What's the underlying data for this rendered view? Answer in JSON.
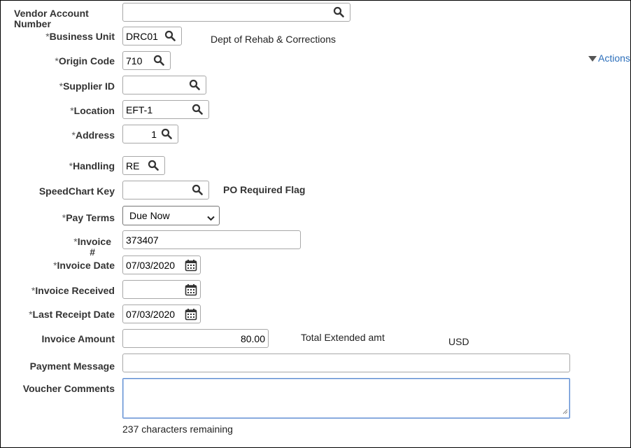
{
  "form": {
    "vendor_account_number": {
      "label": "Vendor Account Number",
      "value": ""
    },
    "business_unit": {
      "label": "Business Unit",
      "value": "DRC01",
      "description": "Dept of Rehab & Corrections"
    },
    "origin_code": {
      "label": "Origin Code",
      "value": "710"
    },
    "supplier_id": {
      "label": "Supplier ID",
      "value": ""
    },
    "location": {
      "label": "Location",
      "value": "EFT-1"
    },
    "address": {
      "label": "Address",
      "value": "1"
    },
    "handling": {
      "label": "Handling",
      "value": "RE"
    },
    "speedchart_key": {
      "label": "SpeedChart Key",
      "value": "",
      "po_required_flag_label": "PO Required Flag"
    },
    "pay_terms": {
      "label": "Pay Terms",
      "value": "Due Now"
    },
    "invoice_number": {
      "label_line1": "Invoice",
      "label_line2": "#",
      "value": "373407"
    },
    "invoice_date": {
      "label": "Invoice Date",
      "value": "07/03/2020"
    },
    "invoice_received": {
      "label": "Invoice Received",
      "value": ""
    },
    "last_receipt_date": {
      "label": "Last Receipt Date",
      "value": "07/03/2020"
    },
    "invoice_amount": {
      "label": "Invoice Amount",
      "value": "80.00",
      "total_label": "Total Extended amt",
      "currency": "USD"
    },
    "payment_message": {
      "label": "Payment Message",
      "value": ""
    },
    "voucher_comments": {
      "label": "Voucher Comments",
      "value": "",
      "remaining": "237 characters remaining"
    }
  },
  "required_marker": "*",
  "actions": {
    "label": "Actions",
    "icon": "triangle-down-icon"
  },
  "icons": {
    "lookup": "magnifier-icon",
    "calendar": "calendar-icon",
    "dropdown": "chevron-down-icon"
  },
  "colors": {
    "link": "#2c6fbb",
    "focus_border": "#5b8bd0",
    "field_border": "#a8a8a8"
  }
}
